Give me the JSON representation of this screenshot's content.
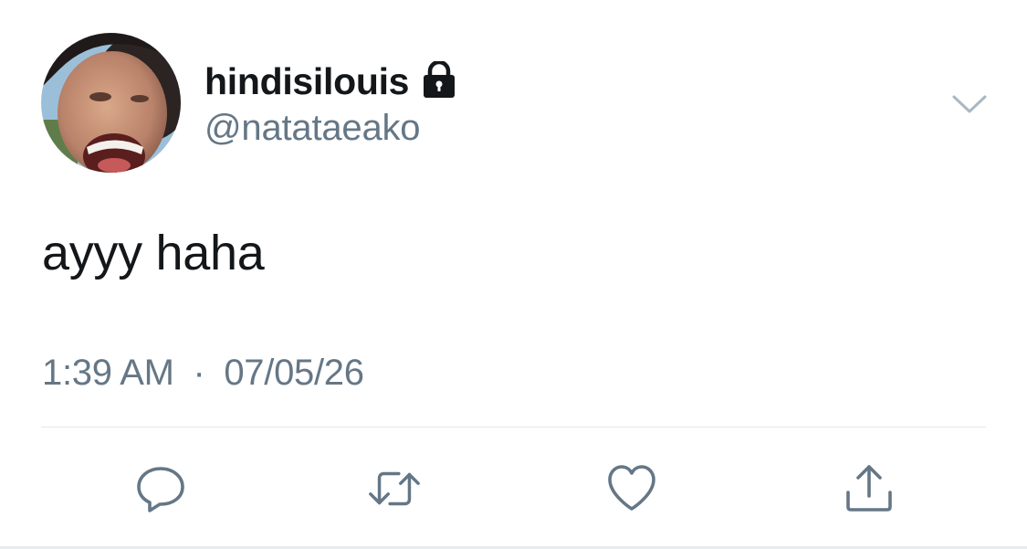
{
  "tweet": {
    "display_name": "hindisilouis",
    "handle": "@natataeako",
    "text": "ayyy haha",
    "time": "1:39 AM",
    "separator": "·",
    "date": "07/05/26",
    "protected": true
  },
  "icons": {
    "lock": "lock-icon",
    "menu": "chevron-down-icon",
    "reply": "reply-icon",
    "retweet": "retweet-icon",
    "like": "heart-icon",
    "share": "share-icon"
  },
  "colors": {
    "primary_text": "#14171a",
    "secondary_text": "#657786",
    "divider": "#e1e8ed",
    "icon": "#657786",
    "background": "#ffffff"
  }
}
